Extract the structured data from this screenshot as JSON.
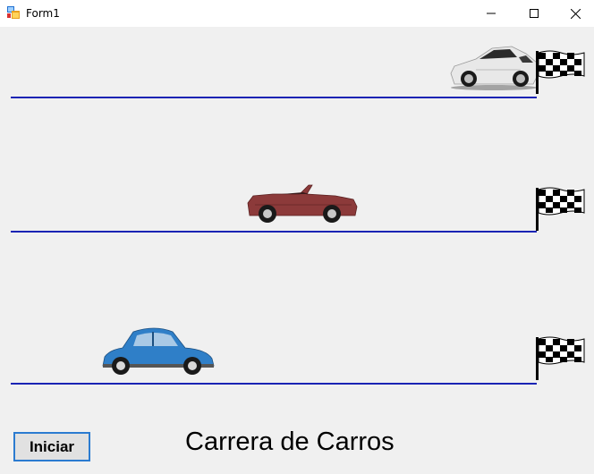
{
  "window": {
    "title": "Form1",
    "icons": {
      "app": "winforms-app-icon",
      "minimize": "minimize-icon",
      "maximize": "maximize-icon",
      "close": "close-icon"
    }
  },
  "race": {
    "lanes": [
      {
        "car": "white-sports-car",
        "color": "#e8e8e8",
        "finish_flag": "checkered-flag-icon",
        "progress": 0.95
      },
      {
        "car": "red-convertible",
        "color": "#8c3a3a",
        "finish_flag": "checkered-flag-icon",
        "progress": 0.45
      },
      {
        "car": "blue-beetle",
        "color": "#2f7fc8",
        "finish_flag": "checkered-flag-icon",
        "progress": 0.18
      }
    ],
    "track_color": "#1a24b4"
  },
  "controls": {
    "start_label": "Iniciar",
    "title": "Carrera de Carros"
  }
}
